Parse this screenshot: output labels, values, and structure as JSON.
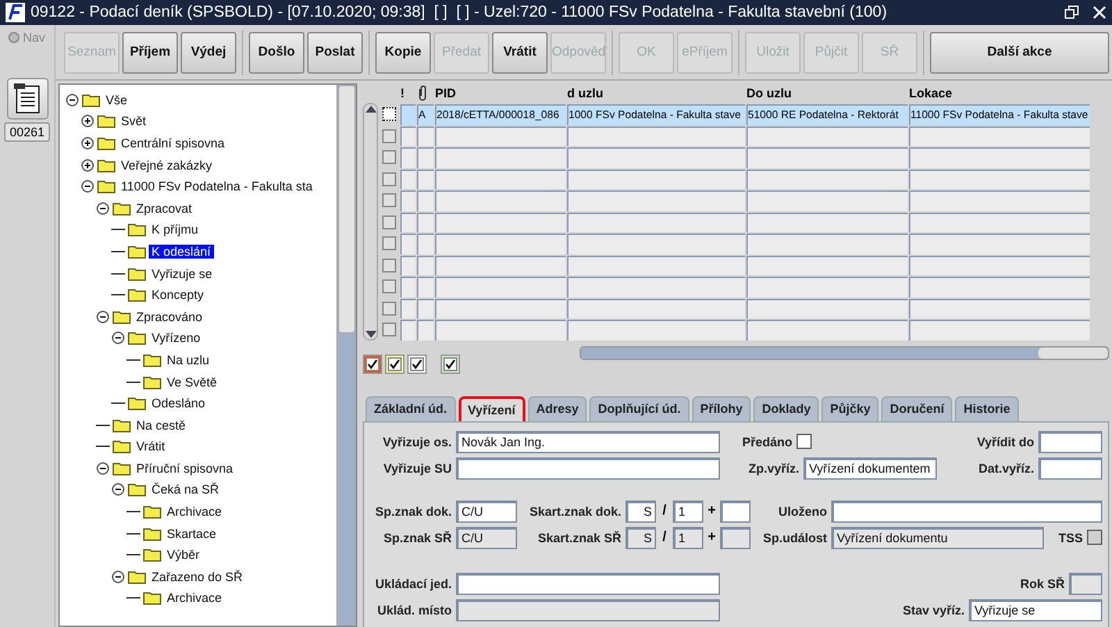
{
  "window": {
    "title": "09122 - Podací deník (SPSBOLD) - [07.10.2020; 09:38]  [ ]  [ ] - Uzel:720 - 11000 FSv Podatelna - Fakulta stavební (100)"
  },
  "rail": {
    "nav": "Nav",
    "counter": "00261"
  },
  "toolbar": [
    {
      "buttons": [
        {
          "label": "Seznam",
          "disabled": true
        },
        {
          "label": "Příjem",
          "disabled": false
        },
        {
          "label": "Výdej",
          "disabled": false
        }
      ]
    },
    {
      "buttons": [
        {
          "label": "Došlo",
          "disabled": false
        },
        {
          "label": "Poslat",
          "disabled": false
        }
      ]
    },
    {
      "buttons": [
        {
          "label": "Kopie",
          "disabled": false
        },
        {
          "label": "Předat",
          "disabled": true
        },
        {
          "label": "Vrátit",
          "disabled": false
        },
        {
          "label": "Odpověď",
          "disabled": true
        }
      ]
    },
    {
      "buttons": [
        {
          "label": "OK",
          "disabled": true
        },
        {
          "label": "ePříjem",
          "disabled": true
        }
      ]
    },
    {
      "buttons": [
        {
          "label": "Uložit",
          "disabled": true
        },
        {
          "label": "Půjčit",
          "disabled": true
        },
        {
          "label": "SŘ",
          "disabled": true
        }
      ]
    },
    {
      "buttons": [
        {
          "label": "Další akce",
          "disabled": false
        }
      ]
    }
  ],
  "tree": [
    {
      "label": "Vše",
      "selected": false,
      "expanded": true,
      "children": [
        {
          "label": "Svět",
          "selected": false,
          "expanded": false
        },
        {
          "label": "Centrální spisovna",
          "selected": false,
          "expanded": false
        },
        {
          "label": "Veřejné zakázky",
          "selected": false,
          "expanded": false
        },
        {
          "label": "11000 FSv Podatelna - Fakulta sta",
          "selected": false,
          "expanded": true,
          "children": [
            {
              "label": "Zpracovat",
              "selected": false,
              "expanded": true,
              "children": [
                {
                  "label": "K příjmu",
                  "selected": false
                },
                {
                  "label": "K odeslání",
                  "selected": true
                },
                {
                  "label": "Vyřizuje se",
                  "selected": false
                },
                {
                  "label": "Koncepty",
                  "selected": false
                }
              ]
            },
            {
              "label": "Zpracováno",
              "selected": false,
              "expanded": true,
              "children": [
                {
                  "label": "Vyřízeno",
                  "selected": false,
                  "expanded": true,
                  "children": [
                    {
                      "label": "Na uzlu",
                      "selected": false
                    },
                    {
                      "label": "Ve Světě",
                      "selected": false
                    }
                  ]
                },
                {
                  "label": "Odesláno",
                  "selected": false
                }
              ]
            },
            {
              "label": "Na cestě",
              "selected": false
            },
            {
              "label": "Vrátit",
              "selected": false
            },
            {
              "label": "Příruční spisovna",
              "selected": false,
              "expanded": true,
              "children": [
                {
                  "label": "Čeká na SŘ",
                  "selected": false,
                  "expanded": true,
                  "children": [
                    {
                      "label": "Archivace",
                      "selected": false
                    },
                    {
                      "label": "Skartace",
                      "selected": false
                    },
                    {
                      "label": "Výběr",
                      "selected": false
                    }
                  ]
                },
                {
                  "label": "Zařazeno do SŘ",
                  "selected": false,
                  "expanded": true,
                  "children": [
                    {
                      "label": "Archivace",
                      "selected": false
                    }
                  ]
                }
              ]
            }
          ]
        }
      ]
    }
  ],
  "table": {
    "columns": [
      {
        "kind": "checkbox"
      },
      {
        "kind": "text",
        "label": "!"
      },
      {
        "kind": "attachment"
      },
      {
        "kind": "text",
        "label": "PID"
      },
      {
        "kind": "text",
        "label": "d uzlu"
      },
      {
        "kind": "text",
        "label": "Do uzlu"
      },
      {
        "kind": "text",
        "label": "Lokace"
      }
    ],
    "rows": [
      {
        "selected": true,
        "checked": false,
        "disabled": false,
        "attachment": "A",
        "pid": "2018/cETTA/000018_086",
        "from_node": "1000 FSv Podatelna - Fakulta stave",
        "to_node": "51000 RE Podatelna - Rektorát",
        "location": "11000 FSv Podatelna - Fakulta stave"
      },
      {
        "selected": false,
        "checked": false,
        "disabled": true
      },
      {
        "selected": false,
        "checked": false,
        "disabled": true
      },
      {
        "selected": false,
        "checked": false,
        "disabled": true
      },
      {
        "selected": false,
        "checked": false,
        "disabled": true
      },
      {
        "selected": false,
        "checked": false,
        "disabled": true
      },
      {
        "selected": false,
        "checked": false,
        "disabled": true
      },
      {
        "selected": false,
        "checked": false,
        "disabled": true
      },
      {
        "selected": false,
        "checked": false,
        "disabled": true
      },
      {
        "selected": false,
        "checked": false,
        "disabled": true
      },
      {
        "selected": false,
        "checked": false,
        "disabled": true
      }
    ]
  },
  "legend": [
    {
      "color": "#e8501c",
      "checked": true
    },
    {
      "color": "#ffff99",
      "checked": true
    },
    {
      "color": "#ffffff",
      "checked": true
    },
    {
      "color": "#c8f0c0",
      "checked": true
    }
  ],
  "tabs": [
    {
      "label": "Základní úd.",
      "selected": false
    },
    {
      "label": "Vyřízení",
      "selected": true
    },
    {
      "label": "Adresy",
      "selected": false
    },
    {
      "label": "Doplňující úd.",
      "selected": false
    },
    {
      "label": "Přílohy",
      "selected": false
    },
    {
      "label": "Doklady",
      "selected": false
    },
    {
      "label": "Půjčky",
      "selected": false
    },
    {
      "label": "Doručení",
      "selected": false
    },
    {
      "label": "Historie",
      "selected": false
    }
  ],
  "form": {
    "vyrizuje_os": {
      "label": "Vyřizuje os.",
      "value": "Novák Jan Ing.",
      "disabled": false
    },
    "predano": {
      "label": "Předáno",
      "checked": false,
      "disabled": false
    },
    "vyridit_do": {
      "label": "Vyřídit do",
      "disabled": false
    },
    "vyrizuje_su": {
      "label": "Vyřizuje SU",
      "disabled": false
    },
    "zp_vyriz": {
      "label": "Zp.vyříz.",
      "value": "Vyřízení dokumentem",
      "disabled": false
    },
    "dat_vyriz": {
      "label": "Dat.vyříz.",
      "disabled": false
    },
    "sp_znak_dok": {
      "label": "Sp.znak dok.",
      "value": "C/U",
      "disabled": false
    },
    "skart_dok": {
      "label": "Skart.znak dok.",
      "znak": "S",
      "sep1": "/",
      "lhuta": "1",
      "sep2": "+",
      "disabled": false
    },
    "ulozeno": {
      "label": "Uloženo",
      "disabled": false
    },
    "sp_znak_sr": {
      "label": "Sp.znak SŘ",
      "value": "C/U",
      "disabled": true
    },
    "skart_sr": {
      "label": "Skart.znak SŘ",
      "znak": "S",
      "sep1": "/",
      "lhuta": "1",
      "sep2": "+",
      "disabled": true
    },
    "sp_udalost": {
      "label": "Sp.událost",
      "value": "Vyřízení dokumentu",
      "disabled": true
    },
    "tss": {
      "label": "TSS",
      "checked": false,
      "disabled": true
    },
    "ukladaci_jed": {
      "label": "Ukládací jed.",
      "disabled": false
    },
    "rok_sr": {
      "label": "Rok SŘ",
      "disabled": true
    },
    "uklad_misto": {
      "label": "Uklád. místo",
      "disabled": true
    },
    "stav_vyriz": {
      "label": "Stav vyříz.",
      "value": "Vyřizuje se",
      "disabled": false
    }
  }
}
